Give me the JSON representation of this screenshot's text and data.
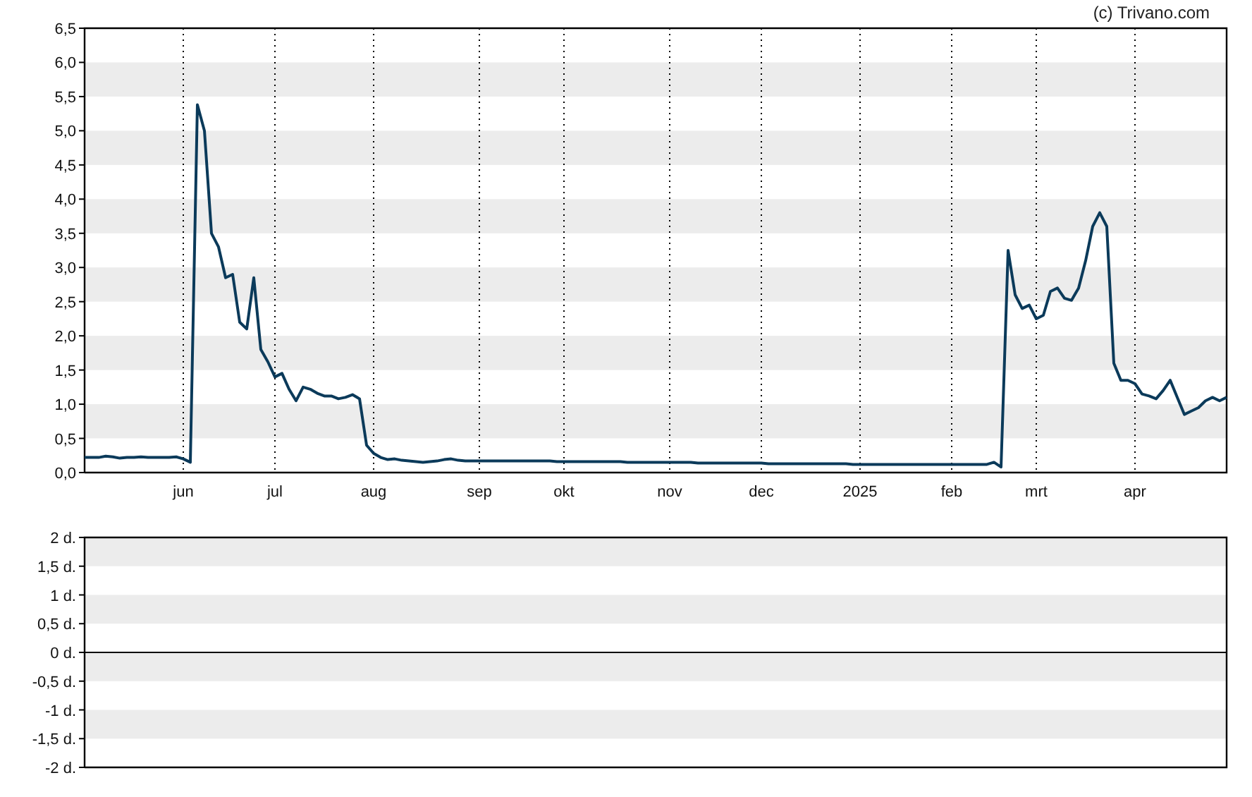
{
  "credit": "(c) Trivano.com",
  "price_chart": {
    "chart_data": {
      "type": "line",
      "ylim": [
        0,
        6.5
      ],
      "yticks": [
        {
          "value": 0,
          "label": "0,0"
        },
        {
          "value": 0.5,
          "label": "0,5"
        },
        {
          "value": 1,
          "label": "1,0"
        },
        {
          "value": 1.5,
          "label": "1,5"
        },
        {
          "value": 2,
          "label": "2,0"
        },
        {
          "value": 2.5,
          "label": "2,5"
        },
        {
          "value": 3,
          "label": "3,0"
        },
        {
          "value": 3.5,
          "label": "3,5"
        },
        {
          "value": 4,
          "label": "4,0"
        },
        {
          "value": 4.5,
          "label": "4,5"
        },
        {
          "value": 5,
          "label": "5,0"
        },
        {
          "value": 5.5,
          "label": "5,5"
        },
        {
          "value": 6,
          "label": "6,0"
        },
        {
          "value": 6.5,
          "label": "6,5"
        }
      ],
      "categories": [
        null,
        null,
        null,
        null,
        null,
        null,
        null,
        null,
        null,
        null,
        null,
        null,
        null,
        null,
        "jun",
        null,
        null,
        null,
        null,
        null,
        null,
        null,
        null,
        null,
        null,
        null,
        null,
        "jul",
        null,
        null,
        null,
        null,
        null,
        null,
        null,
        null,
        null,
        null,
        null,
        null,
        null,
        "aug",
        null,
        null,
        null,
        null,
        null,
        null,
        null,
        null,
        null,
        null,
        null,
        null,
        null,
        null,
        "sep",
        null,
        null,
        null,
        null,
        null,
        null,
        null,
        null,
        null,
        null,
        null,
        "okt",
        null,
        null,
        null,
        null,
        null,
        null,
        null,
        null,
        null,
        null,
        null,
        null,
        null,
        null,
        "nov",
        null,
        null,
        null,
        null,
        null,
        null,
        null,
        null,
        null,
        null,
        null,
        null,
        "dec",
        null,
        null,
        null,
        null,
        null,
        null,
        null,
        null,
        null,
        null,
        null,
        null,
        null,
        "2025",
        null,
        null,
        null,
        null,
        null,
        null,
        null,
        null,
        null,
        null,
        null,
        null,
        "feb",
        null,
        null,
        null,
        null,
        null,
        null,
        null,
        null,
        null,
        null,
        null,
        "mrt",
        null,
        null,
        null,
        null,
        null,
        null,
        null,
        null,
        null,
        null,
        null,
        null,
        null,
        "apr",
        null,
        null,
        null,
        null,
        null,
        null,
        null,
        null,
        null,
        null,
        null,
        null,
        null
      ],
      "series": [
        {
          "color": "#0b3a5a",
          "values": [
            0.22,
            0.22,
            0.22,
            0.24,
            0.23,
            0.21,
            0.22,
            0.22,
            0.23,
            0.22,
            0.22,
            0.22,
            0.22,
            0.23,
            0.2,
            0.15,
            5.38,
            5.0,
            3.5,
            3.3,
            2.85,
            2.9,
            2.2,
            2.1,
            2.85,
            1.8,
            1.62,
            1.4,
            1.45,
            1.22,
            1.05,
            1.25,
            1.22,
            1.16,
            1.12,
            1.12,
            1.08,
            1.1,
            1.14,
            1.08,
            0.4,
            0.28,
            0.22,
            0.19,
            0.2,
            0.18,
            0.17,
            0.16,
            0.15,
            0.16,
            0.17,
            0.19,
            0.2,
            0.18,
            0.17,
            0.17,
            0.17,
            0.17,
            0.17,
            0.17,
            0.17,
            0.17,
            0.17,
            0.17,
            0.17,
            0.17,
            0.17,
            0.16,
            0.16,
            0.16,
            0.16,
            0.16,
            0.16,
            0.16,
            0.16,
            0.16,
            0.16,
            0.15,
            0.15,
            0.15,
            0.15,
            0.15,
            0.15,
            0.15,
            0.15,
            0.15,
            0.15,
            0.14,
            0.14,
            0.14,
            0.14,
            0.14,
            0.14,
            0.14,
            0.14,
            0.14,
            0.14,
            0.13,
            0.13,
            0.13,
            0.13,
            0.13,
            0.13,
            0.13,
            0.13,
            0.13,
            0.13,
            0.13,
            0.13,
            0.12,
            0.12,
            0.12,
            0.12,
            0.12,
            0.12,
            0.12,
            0.12,
            0.12,
            0.12,
            0.12,
            0.12,
            0.12,
            0.12,
            0.12,
            0.12,
            0.12,
            0.12,
            0.12,
            0.12,
            0.15,
            0.08,
            3.25,
            2.6,
            2.4,
            2.45,
            2.25,
            2.3,
            2.65,
            2.7,
            2.55,
            2.52,
            2.7,
            3.1,
            3.6,
            3.8,
            3.6,
            1.6,
            1.35,
            1.35,
            1.3,
            1.15,
            1.12,
            1.08,
            1.2,
            1.35,
            1.1,
            0.85,
            0.9,
            0.95,
            1.05,
            1.1,
            1.05,
            1.1
          ]
        }
      ]
    }
  },
  "volume_panel": {
    "y_labels": [
      "2 d.",
      "1,5 d.",
      "1 d.",
      "0,5 d.",
      "0 d.",
      "-0,5 d.",
      "-1 d.",
      "-1,5 d.",
      "-2 d."
    ]
  }
}
